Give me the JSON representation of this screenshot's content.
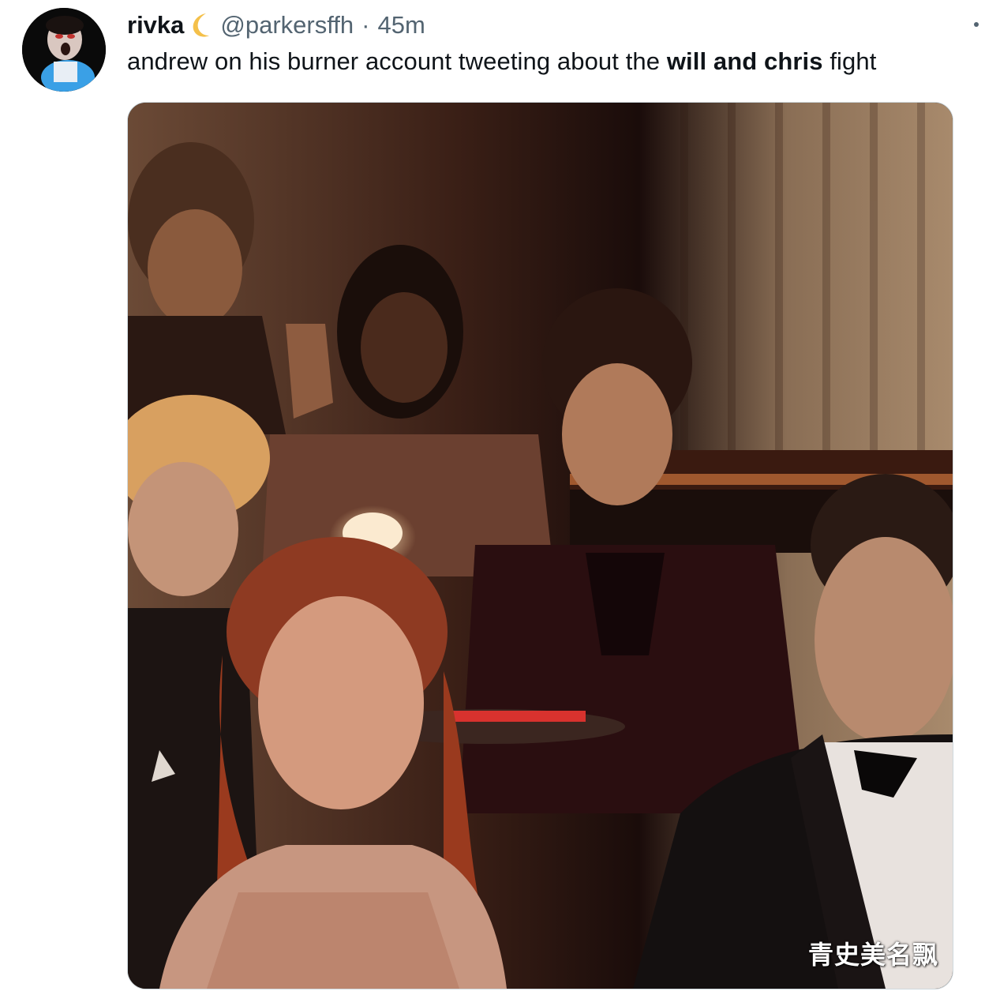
{
  "tweet": {
    "display_name": "rivka",
    "name_emoji": "crescent-moon-icon",
    "handle": "@parkersffh",
    "separator": "·",
    "time": "45m",
    "text_part1": "andrew on his burner account tweeting about the ",
    "text_bold": "will and chris",
    "text_part2": " fight"
  },
  "media": {
    "description_icon": "photo",
    "watermark": "青史美名飘"
  },
  "colors": {
    "text": "#0f1419",
    "secondary": "#536471",
    "moon": "#f4c04a"
  }
}
